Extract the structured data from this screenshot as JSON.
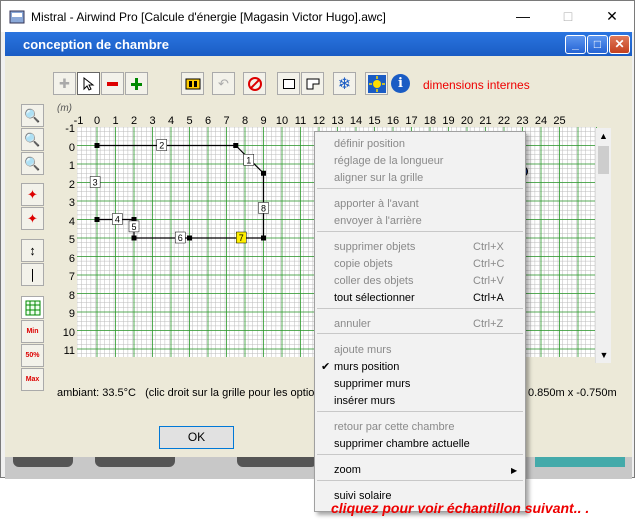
{
  "window": {
    "title": "Mistral - Airwind Pro [Calcule d'énergie [Magasin Victor Hugo].awc]"
  },
  "dialog": {
    "title": "conception de chambre"
  },
  "toolbar": {
    "dimension_label": "dimensions internes"
  },
  "ruler": {
    "unit": "(m)",
    "x_ticks": [
      "-1",
      "0",
      "1",
      "2",
      "3",
      "4",
      "5",
      "6",
      "7",
      "8",
      "9",
      "10",
      "11",
      "12",
      "13",
      "14",
      "15",
      "16",
      "17",
      "18",
      "19",
      "20",
      "21",
      "22",
      "23",
      "24",
      "25"
    ],
    "y_ticks": [
      "-1",
      "0",
      "1",
      "2",
      "3",
      "4",
      "5",
      "6",
      "7",
      "8",
      "9",
      "10",
      "11"
    ]
  },
  "walls": {
    "labels": [
      "1",
      "2",
      "3",
      "4",
      "5",
      "6",
      "7",
      "8"
    ]
  },
  "compass": {
    "label": "N"
  },
  "status": {
    "ambient": "ambiant: 33.5°C",
    "hint": "(clic droit sur la grille pour les options",
    "coords": "0.850m x -0.750m"
  },
  "ok_label": "OK",
  "colors": {
    "title_bar": "#1a5cc4",
    "accent_red": "#e00000",
    "grid_line": "#2a9a2a",
    "highlight_wall": "#ffef00"
  },
  "context_menu": {
    "items": [
      {
        "label": "définir position",
        "shortcut": "",
        "disabled": true,
        "checked": false
      },
      {
        "label": "réglage de la longueur",
        "shortcut": "",
        "disabled": true,
        "checked": false
      },
      {
        "label": "aligner sur la grille",
        "shortcut": "",
        "disabled": true,
        "checked": false
      },
      {
        "label": "apporter à l'avant",
        "shortcut": "",
        "disabled": true,
        "checked": false
      },
      {
        "label": "envoyer à l'arrière",
        "shortcut": "",
        "disabled": true,
        "checked": false
      },
      {
        "label": "supprimer objets",
        "shortcut": "Ctrl+X",
        "disabled": true,
        "checked": false
      },
      {
        "label": "copie objets",
        "shortcut": "Ctrl+C",
        "disabled": true,
        "checked": false
      },
      {
        "label": "coller des objets",
        "shortcut": "Ctrl+V",
        "disabled": true,
        "checked": false
      },
      {
        "label": "tout sélectionner",
        "shortcut": "Ctrl+A",
        "disabled": false,
        "checked": false
      },
      {
        "label": "annuler",
        "shortcut": "Ctrl+Z",
        "disabled": true,
        "checked": false
      },
      {
        "label": "ajoute murs",
        "shortcut": "",
        "disabled": true,
        "checked": false
      },
      {
        "label": "murs position",
        "shortcut": "",
        "disabled": false,
        "checked": true
      },
      {
        "label": "supprimer murs",
        "shortcut": "",
        "disabled": false,
        "checked": false
      },
      {
        "label": "insérer murs",
        "shortcut": "",
        "disabled": false,
        "checked": false
      },
      {
        "label": "retour par cette chambre",
        "shortcut": "",
        "disabled": true,
        "checked": false
      },
      {
        "label": "supprimer chambre actuelle",
        "shortcut": "",
        "disabled": false,
        "checked": false
      },
      {
        "label": "zoom",
        "shortcut": "",
        "disabled": false,
        "checked": false
      },
      {
        "label": "suivi solaire",
        "shortcut": "",
        "disabled": false,
        "checked": false
      }
    ]
  },
  "promo": "cliquez pour voir échantillon suivant.. ."
}
